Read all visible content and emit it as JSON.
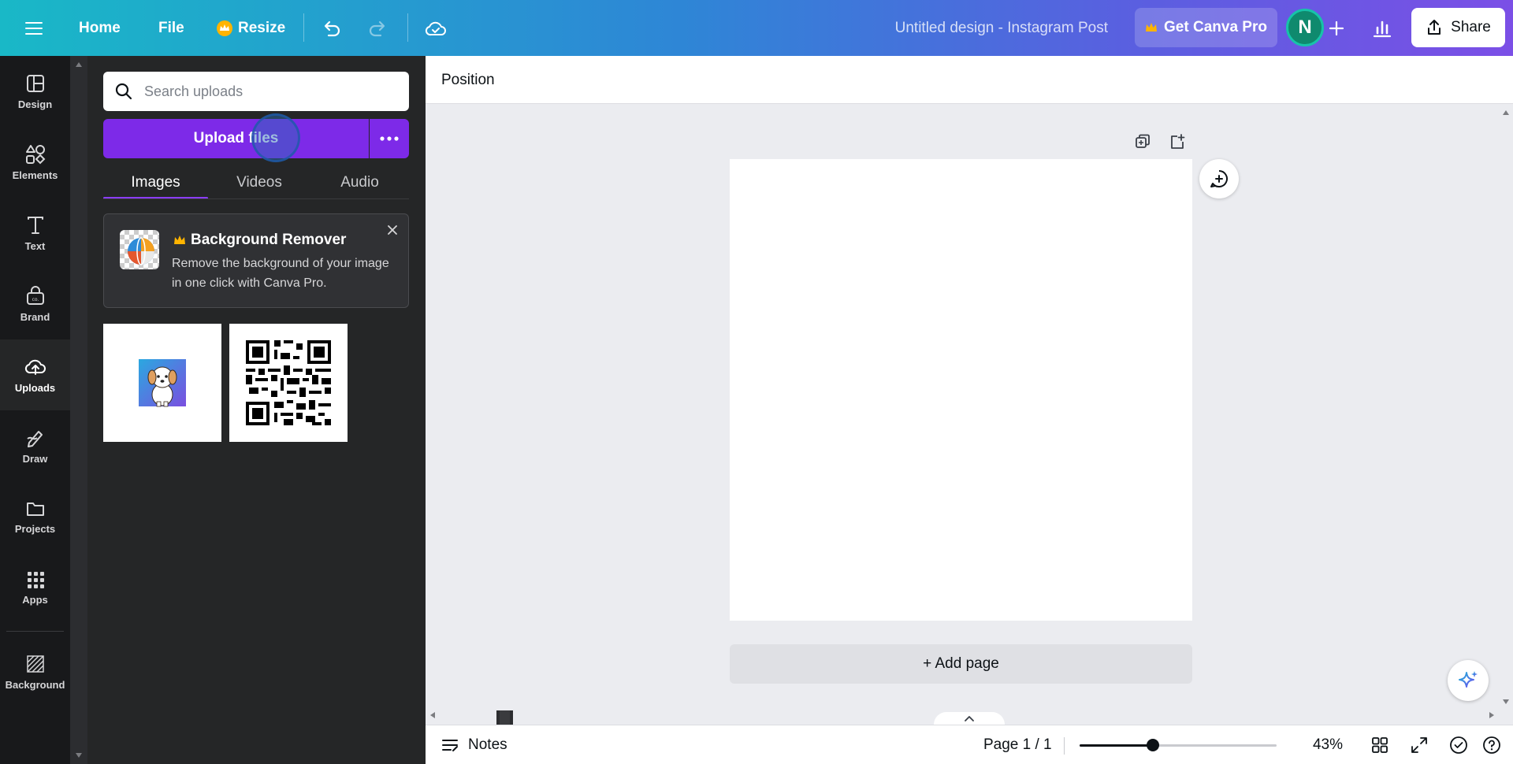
{
  "topbar": {
    "home": "Home",
    "file": "File",
    "resize": "Resize",
    "title": "Untitled design - Instagram Post",
    "get_pro": "Get Canva Pro",
    "avatar_initial": "N",
    "share": "Share"
  },
  "leftnav": {
    "items": [
      {
        "label": "Design",
        "icon": "design-icon"
      },
      {
        "label": "Elements",
        "icon": "elements-icon"
      },
      {
        "label": "Text",
        "icon": "text-icon"
      },
      {
        "label": "Brand",
        "icon": "brand-icon"
      },
      {
        "label": "Uploads",
        "icon": "upload-cloud-icon",
        "active": true
      },
      {
        "label": "Draw",
        "icon": "draw-icon"
      },
      {
        "label": "Projects",
        "icon": "folder-icon"
      },
      {
        "label": "Apps",
        "icon": "apps-grid-icon"
      },
      {
        "label": "Background",
        "icon": "background-icon"
      }
    ]
  },
  "panel": {
    "search_placeholder": "Search uploads",
    "upload_button": "Upload files",
    "tabs": [
      "Images",
      "Videos",
      "Audio"
    ],
    "active_tab": "Images",
    "promo": {
      "title": "Background Remover",
      "description": "Remove the background of your image in one click with Canva Pro."
    },
    "uploads": [
      {
        "name": "dog-illustration"
      },
      {
        "name": "qr-code"
      }
    ]
  },
  "toolbar": {
    "position": "Position"
  },
  "canvas": {
    "add_page": "+ Add page"
  },
  "bottombar": {
    "notes": "Notes",
    "page_indicator": "Page 1 / 1",
    "zoom_percent": 43,
    "zoom_label": "43%"
  },
  "colors": {
    "accent_purple": "#7d2ae8",
    "crown_gold": "#ffb400",
    "panel_bg": "#252627",
    "nav_bg": "#18191b"
  }
}
